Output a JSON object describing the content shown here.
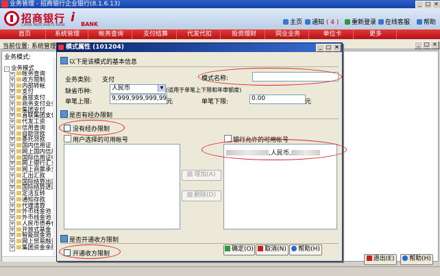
{
  "window": {
    "title": "业务管理 - 招商银行企业银行(8.1.6.13)",
    "min": "_",
    "max": "□",
    "close": "×"
  },
  "brand": {
    "bank_name": "招商银行",
    "bank_en": "CHINA MERCHANTS BANK",
    "ibank_i": "i",
    "ibank_text": "BANK"
  },
  "header_links": {
    "home": "主页",
    "notify": "通知",
    "notify_count": "( 4 )",
    "relogin": "重新登录",
    "online_service": "在线客服",
    "help": "帮助"
  },
  "nav": [
    "首页",
    "系统管理",
    "帐务查询",
    "支付结算",
    "代发代扣",
    "投资理财",
    "同业业务",
    "单位卡",
    "更多"
  ],
  "location": {
    "label": "当前位置:",
    "value": "系统管理"
  },
  "tree": {
    "header": "业务模式:",
    "root": "业务模式",
    "items": [
      "帐务查询",
      "收方限制",
      "内部转帐",
      "支付",
      "直接支付",
      "商务支付业务",
      "集团支付",
      "直联集团支付",
      "代发工资",
      "信用查询",
      "自助贷款",
      "委托贷款",
      "国内信用证",
      "网上国内信用证",
      "国际信用证申",
      "网上银行汇兑",
      "网上商票承兑",
      "汇出汇款",
      "国际结算出口",
      "国际结算进口",
      "定活互转",
      "通知存款",
      "代理清算",
      "外币线金池",
      "外币线金池",
      "人民币债券代",
      "开放式基金",
      "智能现金池",
      "网上贸易融资",
      "集团资金余额"
    ]
  },
  "dialog": {
    "title": "模式属性 (101204)",
    "basic_section": "以下是该模式的基本信息",
    "biz_type_label": "业务类别:",
    "biz_type_value": "支付",
    "mode_name_label": "模式名称:",
    "mode_name_value": "",
    "currency_label": "缺省币种:",
    "currency_value": "人民币",
    "currency_note": "(适用于单笔上下限和年审额度)",
    "upper_label": "单笔上限:",
    "upper_value": "9,999,999,999,999.99",
    "upper_unit": "元",
    "lower_label": "单笔下限:",
    "lower_value": "0.00",
    "lower_unit": "元",
    "account_limit_section": "是否有经办限制",
    "no_limit_checkbox": "没有经办限制",
    "user_accounts_label": "用户选择的可用帐号",
    "bank_accounts_label": "银行允许的可用帐号",
    "bank_account_item_suffix": ",人民币,",
    "add_button": "增加(A)",
    "delete_button": "删除(D)",
    "payee_section": "是否开通收方限制",
    "payee_checkbox": "开通收方限制",
    "ok_button": "确定(O)",
    "cancel_button": "取消(N)",
    "help_button": "帮助(H)"
  },
  "main_buttons": {
    "exit": "退出(E)",
    "help": "帮助(H)"
  },
  "colors": {
    "nav_red": "#c8101a",
    "brand_red": "#c8001e",
    "title_blue": "#0a246a",
    "annotation_red": "#e02020"
  }
}
